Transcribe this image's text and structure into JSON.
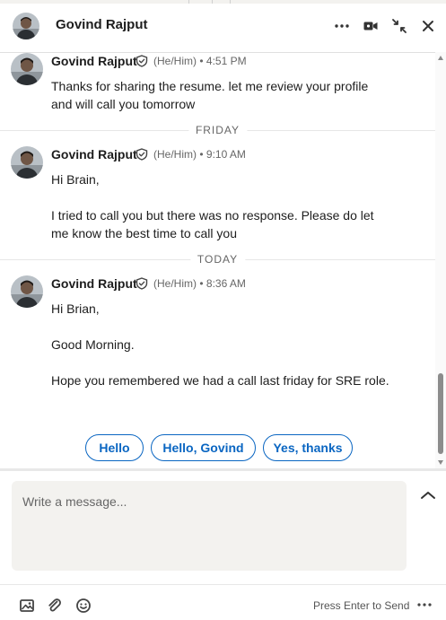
{
  "header": {
    "title": "Govind Rajput"
  },
  "messages": [
    {
      "sender": "Govind Rajput",
      "pronouns": "(He/Him)",
      "time": "4:51 PM",
      "lines": [
        "Thanks for sharing the resume. let me review your profile",
        "and will call you tomorrow"
      ]
    },
    {
      "sender": "Govind Rajput",
      "pronouns": "(He/Him)",
      "time": "9:10 AM",
      "lines": [
        "Hi Brain,",
        "",
        "I tried to call you but there was no response. Please do let",
        "me know the best time to call you"
      ]
    },
    {
      "sender": "Govind Rajput",
      "pronouns": "(He/Him)",
      "time": "8:36 AM",
      "lines": [
        "Hi Brian,",
        "",
        "Good Morning.",
        "",
        "Hope you remembered we had a call last friday for SRE role."
      ]
    }
  ],
  "dividers": {
    "friday": "FRIDAY",
    "today": "TODAY"
  },
  "separator": "•",
  "suggested_replies": [
    "Hello",
    "Hello, Govind",
    "Yes, thanks"
  ],
  "composer": {
    "placeholder": "Write a message..."
  },
  "footer": {
    "send_hint": "Press Enter to Send"
  },
  "icons": {
    "more": "more-horizontal-icon",
    "video": "video-call-icon",
    "minimize": "minimize-icon",
    "close": "close-icon",
    "verified": "verified-shield-icon",
    "image": "image-icon",
    "attach": "paperclip-icon",
    "emoji": "emoji-icon",
    "expand": "chevron-up-icon"
  },
  "colors": {
    "accent": "#0a66c2",
    "composer_bg": "#f3f2ef",
    "meta_text": "#666666"
  }
}
